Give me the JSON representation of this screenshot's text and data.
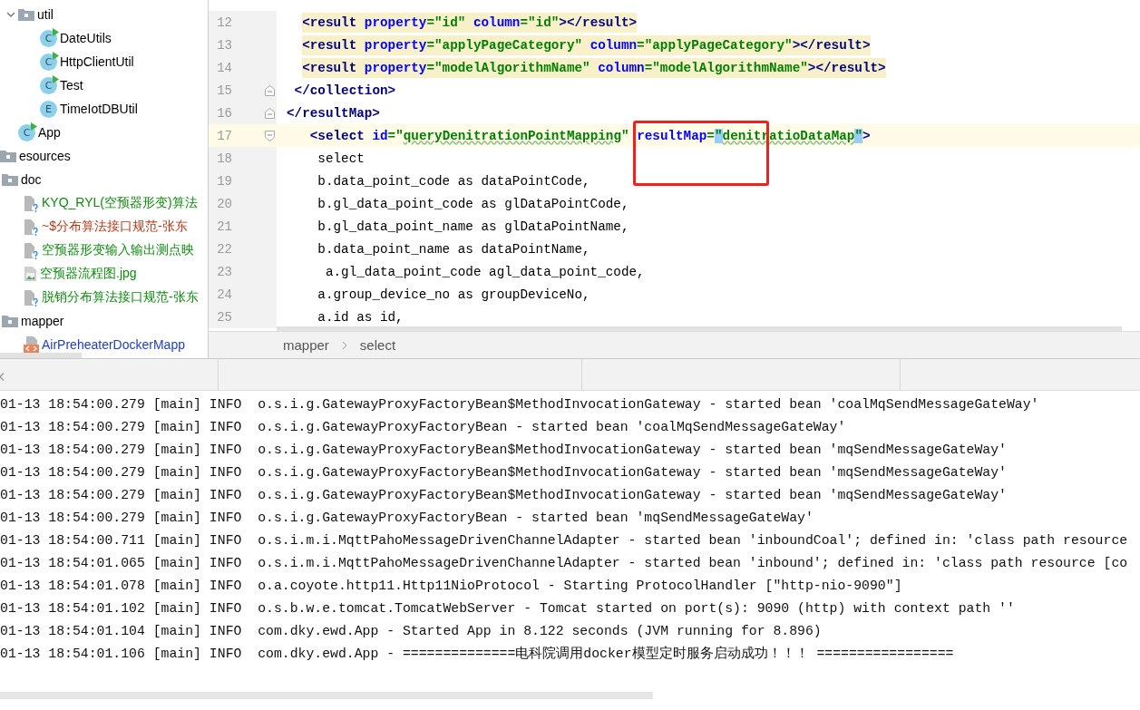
{
  "tree_upper": [
    {
      "label": "util",
      "kind": "folder",
      "expanded": true,
      "color": "#000000",
      "children": [
        {
          "label": "DateUtils",
          "kind": "class",
          "badge": "C",
          "color": "#000000"
        },
        {
          "label": "HttpClientUtil",
          "kind": "class",
          "badge": "C",
          "color": "#000000"
        },
        {
          "label": "Test",
          "kind": "class",
          "badge": "C",
          "color": "#000000"
        },
        {
          "label": "TimeIotDBUtil",
          "kind": "enum",
          "badge": "E",
          "color": "#000000"
        }
      ]
    },
    {
      "label": "App",
      "kind": "class",
      "badge": "C",
      "color": "#000000"
    }
  ],
  "tree_lower": [
    {
      "label": "esources",
      "kind": "folder-cut",
      "color": "#000000",
      "children": [
        {
          "label": "doc",
          "kind": "folder",
          "color": "#000000",
          "children": [
            {
              "label": "KYQ_RYL(空预器形变)算法",
              "kind": "unknown-file",
              "color": "#0f8a0f"
            },
            {
              "label": "~$分布算法接口规范-张东",
              "kind": "unknown-file",
              "color": "#b03a1a"
            },
            {
              "label": "空预器形变输入输出测点映",
              "kind": "unknown-file",
              "color": "#0f8a0f"
            },
            {
              "label": "空预器流程图.jpg",
              "kind": "image-file",
              "color": "#0f8a0f"
            },
            {
              "label": "脱销分布算法接口规范-张东",
              "kind": "unknown-file",
              "color": "#0f8a0f"
            }
          ]
        },
        {
          "label": "mapper",
          "kind": "folder",
          "color": "#000000",
          "children": [
            {
              "label": "AirPreheaterDockerMapp",
              "kind": "xml-file",
              "color": "#1f3fbf"
            }
          ]
        }
      ]
    }
  ],
  "editor": {
    "lines": [
      {
        "number": "12",
        "injected": true,
        "current": false,
        "tokens": [
          {
            "kind": "tag",
            "text": "  <result "
          },
          {
            "kind": "attr",
            "text": "property"
          },
          {
            "kind": "value",
            "text": "=\"id\" "
          },
          {
            "kind": "attr",
            "text": "column"
          },
          {
            "kind": "value",
            "text": "=\"id\""
          },
          {
            "kind": "tag",
            "text": "></result>"
          }
        ]
      },
      {
        "number": "13",
        "injected": true,
        "current": false,
        "tokens": [
          {
            "kind": "tag",
            "text": "  <result "
          },
          {
            "kind": "attr",
            "text": "property"
          },
          {
            "kind": "value",
            "text": "=\"applyPageCategory\" "
          },
          {
            "kind": "attr",
            "text": "column"
          },
          {
            "kind": "value",
            "text": "=\"applyPageCategory\""
          },
          {
            "kind": "tag",
            "text": "></result>"
          }
        ]
      },
      {
        "number": "14",
        "injected": true,
        "current": false,
        "tokens": [
          {
            "kind": "tag",
            "text": "  <result "
          },
          {
            "kind": "attr",
            "text": "property"
          },
          {
            "kind": "value",
            "text": "=\"modelAlgorithmName\" "
          },
          {
            "kind": "attr",
            "text": "column"
          },
          {
            "kind": "value",
            "text": "=\"modelAlgorithmName\""
          },
          {
            "kind": "tag",
            "text": "></result>"
          }
        ]
      },
      {
        "number": "15",
        "injected": false,
        "current": false,
        "fold": {
          "kind": "end"
        },
        "tokens": [
          {
            "kind": "tag",
            "text": " </collection>"
          }
        ]
      },
      {
        "number": "16",
        "injected": false,
        "current": false,
        "fold": {
          "kind": "end"
        },
        "tokens": [
          {
            "kind": "tag",
            "text": "</resultMap>"
          }
        ]
      },
      {
        "number": "17",
        "injected": false,
        "current": true,
        "fold": {
          "kind": "start"
        },
        "tokens": [
          {
            "kind": "tag",
            "text": "   <select "
          },
          {
            "kind": "attr",
            "text": "id"
          },
          {
            "kind": "value",
            "text": "=\""
          },
          {
            "kind": "value-typo",
            "text": "queryDenitrationPointMapping"
          },
          {
            "kind": "value",
            "text": "\" "
          },
          {
            "kind": "attr",
            "text": "resultMap"
          },
          {
            "kind": "value",
            "text": "="
          },
          {
            "kind": "quote-match",
            "text": "\""
          },
          {
            "kind": "value-typo",
            "text": "denitratioDataMap"
          },
          {
            "kind": "quote-match",
            "text": "\""
          },
          {
            "kind": "tag",
            "text": ">"
          }
        ]
      },
      {
        "number": "18",
        "injected": false,
        "current": false,
        "tokens": [
          {
            "kind": "plain",
            "text": "    select"
          }
        ]
      },
      {
        "number": "19",
        "injected": false,
        "current": false,
        "tokens": [
          {
            "kind": "plain",
            "text": "    b.data_point_code as dataPointCode,"
          }
        ]
      },
      {
        "number": "20",
        "injected": false,
        "current": false,
        "tokens": [
          {
            "kind": "plain",
            "text": "    b.gl_data_point_code as glDataPointCode,"
          }
        ]
      },
      {
        "number": "21",
        "injected": false,
        "current": false,
        "tokens": [
          {
            "kind": "plain",
            "text": "    b.gl_data_point_name as glDataPointName,"
          }
        ]
      },
      {
        "number": "22",
        "injected": false,
        "current": false,
        "tokens": [
          {
            "kind": "plain",
            "text": "    b.data_point_name as dataPointName,"
          }
        ]
      },
      {
        "number": "23",
        "injected": false,
        "current": false,
        "tokens": [
          {
            "kind": "plain",
            "text": "     a.gl_data_point_code agl_data_point_code,"
          }
        ]
      },
      {
        "number": "24",
        "injected": false,
        "current": false,
        "tokens": [
          {
            "kind": "plain",
            "text": "    a.group_device_no as groupDeviceNo,"
          }
        ]
      },
      {
        "number": "25",
        "injected": false,
        "current": false,
        "tokens": [
          {
            "kind": "plain",
            "text": "    a.id as id,"
          }
        ]
      }
    ],
    "annotation": {
      "kind": "rectangle"
    }
  },
  "breadcrumb": [
    "mapper",
    "select"
  ],
  "console_lines": [
    "01-13 18:54:00.279 [main] INFO  o.s.i.g.GatewayProxyFactoryBean$MethodInvocationGateway - started bean 'coalMqSendMessageGateWay'",
    "01-13 18:54:00.279 [main] INFO  o.s.i.g.GatewayProxyFactoryBean - started bean 'coalMqSendMessageGateWay'",
    "01-13 18:54:00.279 [main] INFO  o.s.i.g.GatewayProxyFactoryBean$MethodInvocationGateway - started bean 'mqSendMessageGateWay'",
    "01-13 18:54:00.279 [main] INFO  o.s.i.g.GatewayProxyFactoryBean$MethodInvocationGateway - started bean 'mqSendMessageGateWay'",
    "01-13 18:54:00.279 [main] INFO  o.s.i.g.GatewayProxyFactoryBean$MethodInvocationGateway - started bean 'mqSendMessageGateWay'",
    "01-13 18:54:00.279 [main] INFO  o.s.i.g.GatewayProxyFactoryBean - started bean 'mqSendMessageGateWay'",
    "01-13 18:54:00.711 [main] INFO  o.s.i.m.i.MqttPahoMessageDrivenChannelAdapter - started bean 'inboundCoal'; defined in: 'class path resource",
    "01-13 18:54:01.065 [main] INFO  o.s.i.m.i.MqttPahoMessageDrivenChannelAdapter - started bean 'inbound'; defined in: 'class path resource [co",
    "01-13 18:54:01.078 [main] INFO  o.a.coyote.http11.Http11NioProtocol - Starting ProtocolHandler [\"http-nio-9090\"]",
    "01-13 18:54:01.102 [main] INFO  o.s.b.w.e.tomcat.TomcatWebServer - Tomcat started on port(s): 9090 (http) with context path ''",
    "01-13 18:54:01.104 [main] INFO  com.dky.ewd.App - Started App in 8.122 seconds (JVM running for 8.896)",
    "01-13 18:54:01.106 [main] INFO  com.dky.ewd.App - ==============电科院调用docker模型定时服务启动成功！！！ ================="
  ]
}
